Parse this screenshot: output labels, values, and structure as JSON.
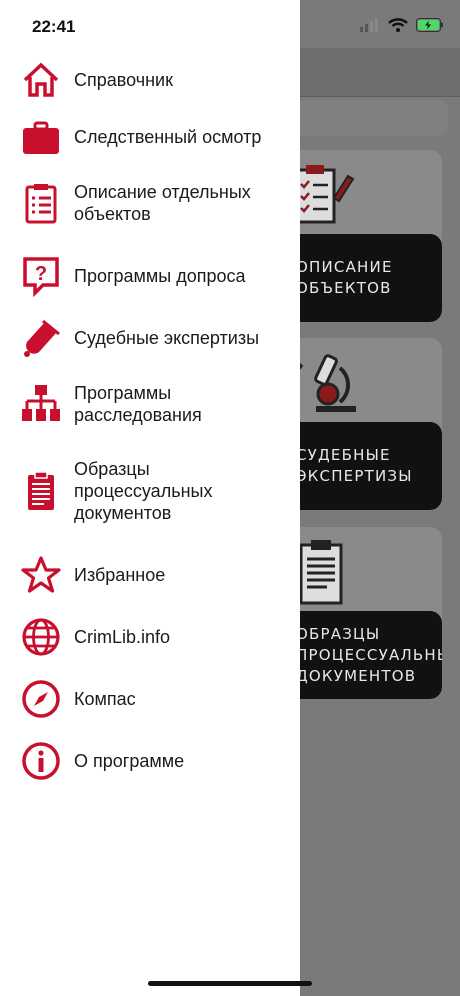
{
  "status": {
    "time": "22:41"
  },
  "drawer": {
    "items": [
      {
        "label": "Справочник",
        "icon": "home-icon"
      },
      {
        "label": "Следственный осмотр",
        "icon": "briefcase-icon"
      },
      {
        "label": "Описание отдельных\nобъектов",
        "icon": "clipboard-list-icon"
      },
      {
        "label": "Программы допроса",
        "icon": "question-bubble-icon"
      },
      {
        "label": "Судебные экспертизы",
        "icon": "test-tube-icon"
      },
      {
        "label": "Программы\nрасследования",
        "icon": "org-chart-icon"
      },
      {
        "label": "Образцы\nпроцессуальных\nдокументов",
        "icon": "document-clipboard-icon"
      },
      {
        "label": "Избранное",
        "icon": "star-icon"
      },
      {
        "label": "CrimLib.info",
        "icon": "globe-icon"
      },
      {
        "label": "Компас",
        "icon": "compass-icon"
      },
      {
        "label": "О программе",
        "icon": "info-icon"
      }
    ]
  },
  "background": {
    "cards": [
      {
        "label": "Описание\nобъектов"
      },
      {
        "label": "Судебные\nэкспертизы"
      },
      {
        "label": "Образцы\nпроцессуальных\nдокументов"
      }
    ]
  },
  "colors": {
    "accent": "#c8102e",
    "drawer_bg": "#ffffff",
    "overlay": "#7a7a7a"
  }
}
